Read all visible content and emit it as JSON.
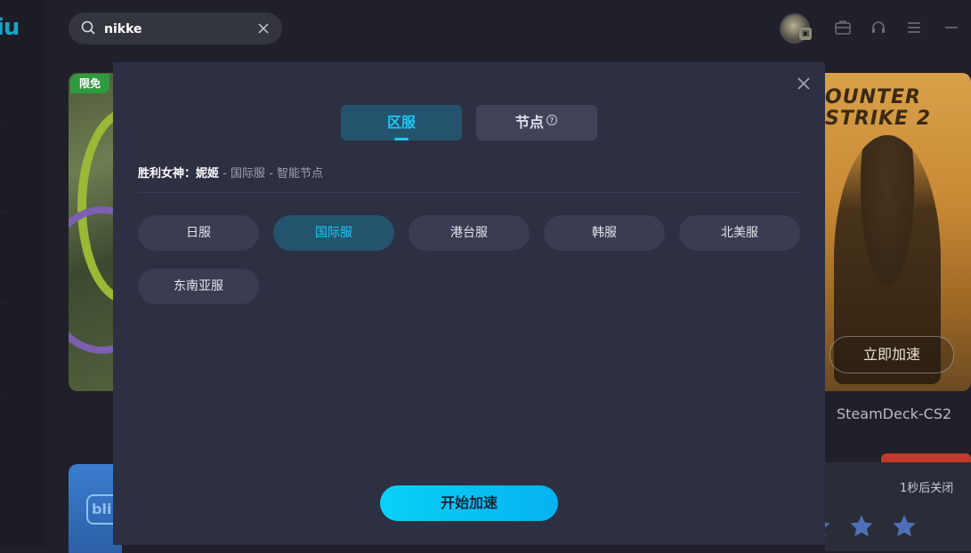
{
  "app": {
    "logo_text": "iu"
  },
  "search": {
    "value": "nikke",
    "placeholder": ""
  },
  "cards": {
    "left_badge": "限免",
    "right_banner_text": "OUNTER\nSTRIKE 2",
    "right_button": "立即加速",
    "right_title": "SteamDeck-CS2",
    "bottom_left_text": "bli",
    "close_timer": "1秒后关闭"
  },
  "modal": {
    "tabs": [
      {
        "label": "区服",
        "active": true
      },
      {
        "label": "节点",
        "active": false
      }
    ],
    "game_name": "胜利女神：妮姬",
    "separator": " - ",
    "selected_region_text": "国际服",
    "selected_node_text": "智能节点",
    "regions": [
      "日服",
      "国际服",
      "港台服",
      "韩服",
      "北美服",
      "东南亚服"
    ],
    "selected_region_index": 1,
    "start_button": "开始加速"
  },
  "colors": {
    "accent": "#1fc8f5",
    "modal_bg": "#2d2f43",
    "chip_bg": "#3a3c52",
    "chip_selected_bg": "#24536e"
  }
}
